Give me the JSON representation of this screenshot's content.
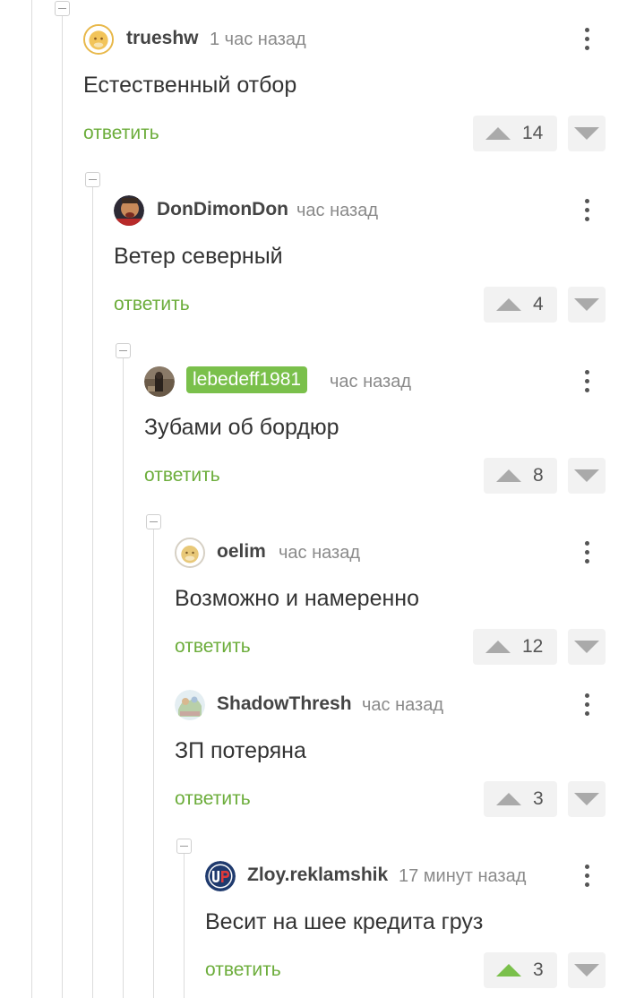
{
  "comments": [
    {
      "author": "trueshw",
      "time": "1 час назад",
      "text": "Естественный отбор",
      "reply_label": "ответить",
      "votes": "14",
      "avatar": "yellow-face-avatar"
    },
    {
      "author": "DonDimonDon",
      "time": "час назад",
      "text": "Ветер северный",
      "reply_label": "ответить",
      "votes": "4",
      "avatar": "photo-avatar"
    },
    {
      "author": "lebedeff1981",
      "time": "час назад",
      "text": "Зубами об бордюр",
      "reply_label": "ответить",
      "votes": "8",
      "avatar": "photo-avatar",
      "author_badge_color": "#7ac04b"
    },
    {
      "author": "oelim",
      "time": "час назад",
      "text": "Возможно и намеренно",
      "reply_label": "ответить",
      "votes": "12",
      "avatar": "beige-face-avatar"
    },
    {
      "author": "ShadowThresh",
      "time": "час назад",
      "text": "ЗП потеряна",
      "reply_label": "ответить",
      "votes": "3",
      "avatar": "drawing-avatar"
    },
    {
      "author": "Zloy.reklamshik",
      "time": "17 минут назад",
      "text": "Весит на шее кредита груз",
      "reply_label": "ответить",
      "votes": "3",
      "avatar": "up-logo-avatar",
      "upvoted": true
    }
  ],
  "colors": {
    "reply_green": "#6cad3b",
    "upvote_active": "#7ac04b",
    "vote_arrow": "#aaaaaa",
    "vote_bg": "#f2f2f2"
  }
}
